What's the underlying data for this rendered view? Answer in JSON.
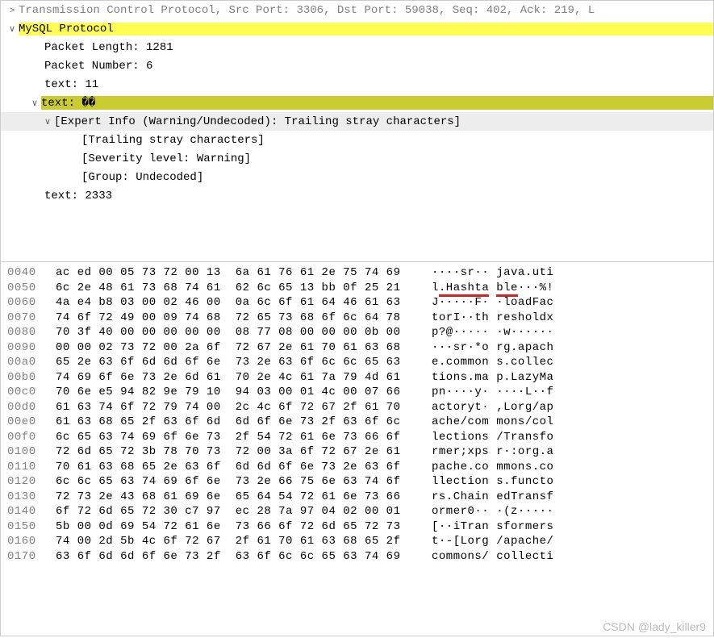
{
  "tree": {
    "tcp_line": "Transmission Control Protocol, Src Port: 3306, Dst Port: 59038, Seq: 402, Ack: 219, L",
    "mysql_protocol": "MySQL Protocol",
    "packet_length": "Packet Length: 1281",
    "packet_number": "Packet Number: 6",
    "text_11": "text: 11",
    "text_glyph": "text: ��",
    "expert_info": "[Expert Info (Warning/Undecoded): Trailing stray characters]",
    "trailing": "[Trailing stray characters]",
    "severity": "[Severity level: Warning]",
    "group": "[Group: Undecoded]",
    "text_2333": "text: 2333"
  },
  "hex": [
    {
      "o": "0040",
      "b1": "ac ed 00 05 73 72 00 13",
      "b2": "6a 61 76 61 2e 75 74 69",
      "a1": "····sr··",
      "a2": "java.uti"
    },
    {
      "o": "0050",
      "b1": "6c 2e 48 61 73 68 74 61",
      "b2": "62 6c 65 13 bb 0f 25 21",
      "a1": "l.Hashta",
      "a2": "ble···%!",
      "ul": true
    },
    {
      "o": "0060",
      "b1": "4a e4 b8 03 00 02 46 00",
      "b2": "0a 6c 6f 61 64 46 61 63",
      "a1": "J·····F·",
      "a2": "·loadFac"
    },
    {
      "o": "0070",
      "b1": "74 6f 72 49 00 09 74 68",
      "b2": "72 65 73 68 6f 6c 64 78",
      "a1": "torI··th",
      "a2": "resholdx"
    },
    {
      "o": "0080",
      "b1": "70 3f 40 00 00 00 00 00",
      "b2": "08 77 08 00 00 00 0b 00",
      "a1": "p?@·····",
      "a2": "·w······"
    },
    {
      "o": "0090",
      "b1": "00 00 02 73 72 00 2a 6f",
      "b2": "72 67 2e 61 70 61 63 68",
      "a1": "···sr·*o",
      "a2": "rg.apach"
    },
    {
      "o": "00a0",
      "b1": "65 2e 63 6f 6d 6d 6f 6e",
      "b2": "73 2e 63 6f 6c 6c 65 63",
      "a1": "e.common",
      "a2": "s.collec"
    },
    {
      "o": "00b0",
      "b1": "74 69 6f 6e 73 2e 6d 61",
      "b2": "70 2e 4c 61 7a 79 4d 61",
      "a1": "tions.ma",
      "a2": "p.LazyMa"
    },
    {
      "o": "00c0",
      "b1": "70 6e e5 94 82 9e 79 10",
      "b2": "94 03 00 01 4c 00 07 66",
      "a1": "pn····y·",
      "a2": "····L··f"
    },
    {
      "o": "00d0",
      "b1": "61 63 74 6f 72 79 74 00",
      "b2": "2c 4c 6f 72 67 2f 61 70",
      "a1": "actoryt·",
      "a2": ",Lorg/ap"
    },
    {
      "o": "00e0",
      "b1": "61 63 68 65 2f 63 6f 6d",
      "b2": "6d 6f 6e 73 2f 63 6f 6c",
      "a1": "ache/com",
      "a2": "mons/col"
    },
    {
      "o": "00f0",
      "b1": "6c 65 63 74 69 6f 6e 73",
      "b2": "2f 54 72 61 6e 73 66 6f",
      "a1": "lections",
      "a2": "/Transfo"
    },
    {
      "o": "0100",
      "b1": "72 6d 65 72 3b 78 70 73",
      "b2": "72 00 3a 6f 72 67 2e 61",
      "a1": "rmer;xps",
      "a2": "r·:org.a"
    },
    {
      "o": "0110",
      "b1": "70 61 63 68 65 2e 63 6f",
      "b2": "6d 6d 6f 6e 73 2e 63 6f",
      "a1": "pache.co",
      "a2": "mmons.co"
    },
    {
      "o": "0120",
      "b1": "6c 6c 65 63 74 69 6f 6e",
      "b2": "73 2e 66 75 6e 63 74 6f",
      "a1": "llection",
      "a2": "s.functo"
    },
    {
      "o": "0130",
      "b1": "72 73 2e 43 68 61 69 6e",
      "b2": "65 64 54 72 61 6e 73 66",
      "a1": "rs.Chain",
      "a2": "edTransf"
    },
    {
      "o": "0140",
      "b1": "6f 72 6d 65 72 30 c7 97",
      "b2": "ec 28 7a 97 04 02 00 01",
      "a1": "ormer0··",
      "a2": "·(z·····"
    },
    {
      "o": "0150",
      "b1": "5b 00 0d 69 54 72 61 6e",
      "b2": "73 66 6f 72 6d 65 72 73",
      "a1": "[··iTran",
      "a2": "sformers"
    },
    {
      "o": "0160",
      "b1": "74 00 2d 5b 4c 6f 72 67",
      "b2": "2f 61 70 61 63 68 65 2f",
      "a1": "t·-[Lorg",
      "a2": "/apache/"
    },
    {
      "o": "0170",
      "b1": "63 6f 6d 6d 6f 6e 73 2f",
      "b2": "63 6f 6c 6c 65 63 74 69",
      "a1": "commons/",
      "a2": "collecti"
    }
  ],
  "watermark": "CSDN @lady_killer9"
}
